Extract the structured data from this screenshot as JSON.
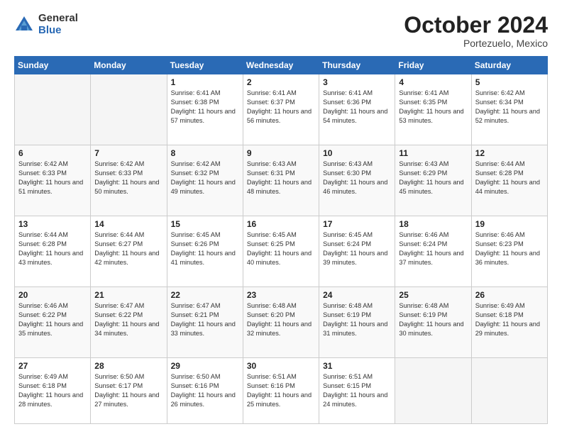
{
  "header": {
    "logo_general": "General",
    "logo_blue": "Blue",
    "title": "October 2024",
    "location": "Portezuelo, Mexico"
  },
  "weekdays": [
    "Sunday",
    "Monday",
    "Tuesday",
    "Wednesday",
    "Thursday",
    "Friday",
    "Saturday"
  ],
  "weeks": [
    [
      {
        "day": "",
        "empty": true
      },
      {
        "day": "",
        "empty": true
      },
      {
        "day": "1",
        "sunrise": "Sunrise: 6:41 AM",
        "sunset": "Sunset: 6:38 PM",
        "daylight": "Daylight: 11 hours and 57 minutes."
      },
      {
        "day": "2",
        "sunrise": "Sunrise: 6:41 AM",
        "sunset": "Sunset: 6:37 PM",
        "daylight": "Daylight: 11 hours and 56 minutes."
      },
      {
        "day": "3",
        "sunrise": "Sunrise: 6:41 AM",
        "sunset": "Sunset: 6:36 PM",
        "daylight": "Daylight: 11 hours and 54 minutes."
      },
      {
        "day": "4",
        "sunrise": "Sunrise: 6:41 AM",
        "sunset": "Sunset: 6:35 PM",
        "daylight": "Daylight: 11 hours and 53 minutes."
      },
      {
        "day": "5",
        "sunrise": "Sunrise: 6:42 AM",
        "sunset": "Sunset: 6:34 PM",
        "daylight": "Daylight: 11 hours and 52 minutes."
      }
    ],
    [
      {
        "day": "6",
        "sunrise": "Sunrise: 6:42 AM",
        "sunset": "Sunset: 6:33 PM",
        "daylight": "Daylight: 11 hours and 51 minutes."
      },
      {
        "day": "7",
        "sunrise": "Sunrise: 6:42 AM",
        "sunset": "Sunset: 6:33 PM",
        "daylight": "Daylight: 11 hours and 50 minutes."
      },
      {
        "day": "8",
        "sunrise": "Sunrise: 6:42 AM",
        "sunset": "Sunset: 6:32 PM",
        "daylight": "Daylight: 11 hours and 49 minutes."
      },
      {
        "day": "9",
        "sunrise": "Sunrise: 6:43 AM",
        "sunset": "Sunset: 6:31 PM",
        "daylight": "Daylight: 11 hours and 48 minutes."
      },
      {
        "day": "10",
        "sunrise": "Sunrise: 6:43 AM",
        "sunset": "Sunset: 6:30 PM",
        "daylight": "Daylight: 11 hours and 46 minutes."
      },
      {
        "day": "11",
        "sunrise": "Sunrise: 6:43 AM",
        "sunset": "Sunset: 6:29 PM",
        "daylight": "Daylight: 11 hours and 45 minutes."
      },
      {
        "day": "12",
        "sunrise": "Sunrise: 6:44 AM",
        "sunset": "Sunset: 6:28 PM",
        "daylight": "Daylight: 11 hours and 44 minutes."
      }
    ],
    [
      {
        "day": "13",
        "sunrise": "Sunrise: 6:44 AM",
        "sunset": "Sunset: 6:28 PM",
        "daylight": "Daylight: 11 hours and 43 minutes."
      },
      {
        "day": "14",
        "sunrise": "Sunrise: 6:44 AM",
        "sunset": "Sunset: 6:27 PM",
        "daylight": "Daylight: 11 hours and 42 minutes."
      },
      {
        "day": "15",
        "sunrise": "Sunrise: 6:45 AM",
        "sunset": "Sunset: 6:26 PM",
        "daylight": "Daylight: 11 hours and 41 minutes."
      },
      {
        "day": "16",
        "sunrise": "Sunrise: 6:45 AM",
        "sunset": "Sunset: 6:25 PM",
        "daylight": "Daylight: 11 hours and 40 minutes."
      },
      {
        "day": "17",
        "sunrise": "Sunrise: 6:45 AM",
        "sunset": "Sunset: 6:24 PM",
        "daylight": "Daylight: 11 hours and 39 minutes."
      },
      {
        "day": "18",
        "sunrise": "Sunrise: 6:46 AM",
        "sunset": "Sunset: 6:24 PM",
        "daylight": "Daylight: 11 hours and 37 minutes."
      },
      {
        "day": "19",
        "sunrise": "Sunrise: 6:46 AM",
        "sunset": "Sunset: 6:23 PM",
        "daylight": "Daylight: 11 hours and 36 minutes."
      }
    ],
    [
      {
        "day": "20",
        "sunrise": "Sunrise: 6:46 AM",
        "sunset": "Sunset: 6:22 PM",
        "daylight": "Daylight: 11 hours and 35 minutes."
      },
      {
        "day": "21",
        "sunrise": "Sunrise: 6:47 AM",
        "sunset": "Sunset: 6:22 PM",
        "daylight": "Daylight: 11 hours and 34 minutes."
      },
      {
        "day": "22",
        "sunrise": "Sunrise: 6:47 AM",
        "sunset": "Sunset: 6:21 PM",
        "daylight": "Daylight: 11 hours and 33 minutes."
      },
      {
        "day": "23",
        "sunrise": "Sunrise: 6:48 AM",
        "sunset": "Sunset: 6:20 PM",
        "daylight": "Daylight: 11 hours and 32 minutes."
      },
      {
        "day": "24",
        "sunrise": "Sunrise: 6:48 AM",
        "sunset": "Sunset: 6:19 PM",
        "daylight": "Daylight: 11 hours and 31 minutes."
      },
      {
        "day": "25",
        "sunrise": "Sunrise: 6:48 AM",
        "sunset": "Sunset: 6:19 PM",
        "daylight": "Daylight: 11 hours and 30 minutes."
      },
      {
        "day": "26",
        "sunrise": "Sunrise: 6:49 AM",
        "sunset": "Sunset: 6:18 PM",
        "daylight": "Daylight: 11 hours and 29 minutes."
      }
    ],
    [
      {
        "day": "27",
        "sunrise": "Sunrise: 6:49 AM",
        "sunset": "Sunset: 6:18 PM",
        "daylight": "Daylight: 11 hours and 28 minutes."
      },
      {
        "day": "28",
        "sunrise": "Sunrise: 6:50 AM",
        "sunset": "Sunset: 6:17 PM",
        "daylight": "Daylight: 11 hours and 27 minutes."
      },
      {
        "day": "29",
        "sunrise": "Sunrise: 6:50 AM",
        "sunset": "Sunset: 6:16 PM",
        "daylight": "Daylight: 11 hours and 26 minutes."
      },
      {
        "day": "30",
        "sunrise": "Sunrise: 6:51 AM",
        "sunset": "Sunset: 6:16 PM",
        "daylight": "Daylight: 11 hours and 25 minutes."
      },
      {
        "day": "31",
        "sunrise": "Sunrise: 6:51 AM",
        "sunset": "Sunset: 6:15 PM",
        "daylight": "Daylight: 11 hours and 24 minutes."
      },
      {
        "day": "",
        "empty": true
      },
      {
        "day": "",
        "empty": true
      }
    ]
  ]
}
